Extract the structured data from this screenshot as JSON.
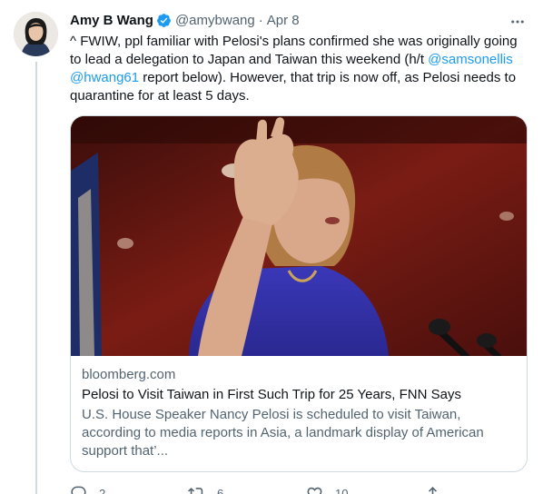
{
  "tweet": {
    "author_name": "Amy B Wang",
    "handle": "@amybwang",
    "separator": "·",
    "date": "Apr 8",
    "text_part1": "^ FWIW, ppl familiar with Pelosi's plans confirmed she was originally going to lead a delegation to Japan and Taiwan this weekend (h/t ",
    "mention1": "@samsonellis",
    "mention2": "@hwang61",
    "text_part2": " report below). However, that trip is now off, as Pelosi needs to quarantine for at least 5 days."
  },
  "card": {
    "domain": "bloomberg.com",
    "title": "Pelosi to Visit Taiwan in First Such Trip for 25 Years, FNN Says",
    "description": "U.S. House Speaker Nancy Pelosi is scheduled to visit Taiwan, according to media reports in Asia, a landmark display of American support that’..."
  },
  "actions": {
    "replies": "2",
    "retweets": "6",
    "likes": "10"
  },
  "colors": {
    "accent": "#1d9bf0",
    "secondary_text": "#536471",
    "border": "#cfd9de"
  },
  "icons": [
    "verified-badge-icon",
    "more-icon",
    "reply-icon",
    "retweet-icon",
    "like-icon",
    "share-icon"
  ]
}
